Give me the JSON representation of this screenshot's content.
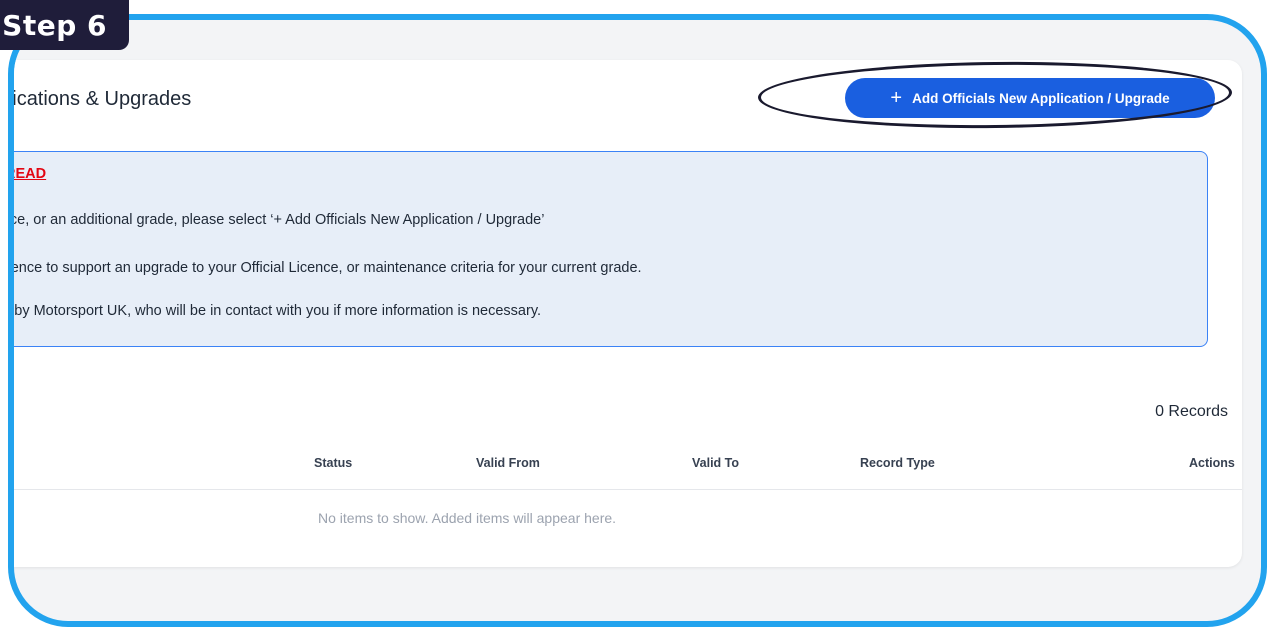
{
  "step_label": "Step 6",
  "page": {
    "title": "Officials Applications & Upgrades",
    "add_button_label": "Add Officials New Application / Upgrade",
    "add_button_icon": "plus-icon"
  },
  "notice": {
    "heading": "PLEASE READ",
    "lines": [
      "To apply for an Official Licence, or an additional grade, please select ‘+ Add Officials New Application / Upgrade’",
      "This section can be used to upload evidence to support an upgrade to your Official Licence, or maintenance criteria for your current grade.",
      "Applications are reviewed by Motorsport UK, who will be in contact with you if more information is necessary."
    ]
  },
  "table": {
    "record_count": "0 Records",
    "columns": [
      "Status",
      "Valid From",
      "Valid To",
      "Record Type",
      "Actions"
    ],
    "empty_message": "No items to show. Added items will appear here."
  },
  "colors": {
    "frame_border": "#22a3ee",
    "button_blue": "#1a5fe0",
    "warning_red": "#e30613",
    "notice_bg": "#e7eef8"
  }
}
